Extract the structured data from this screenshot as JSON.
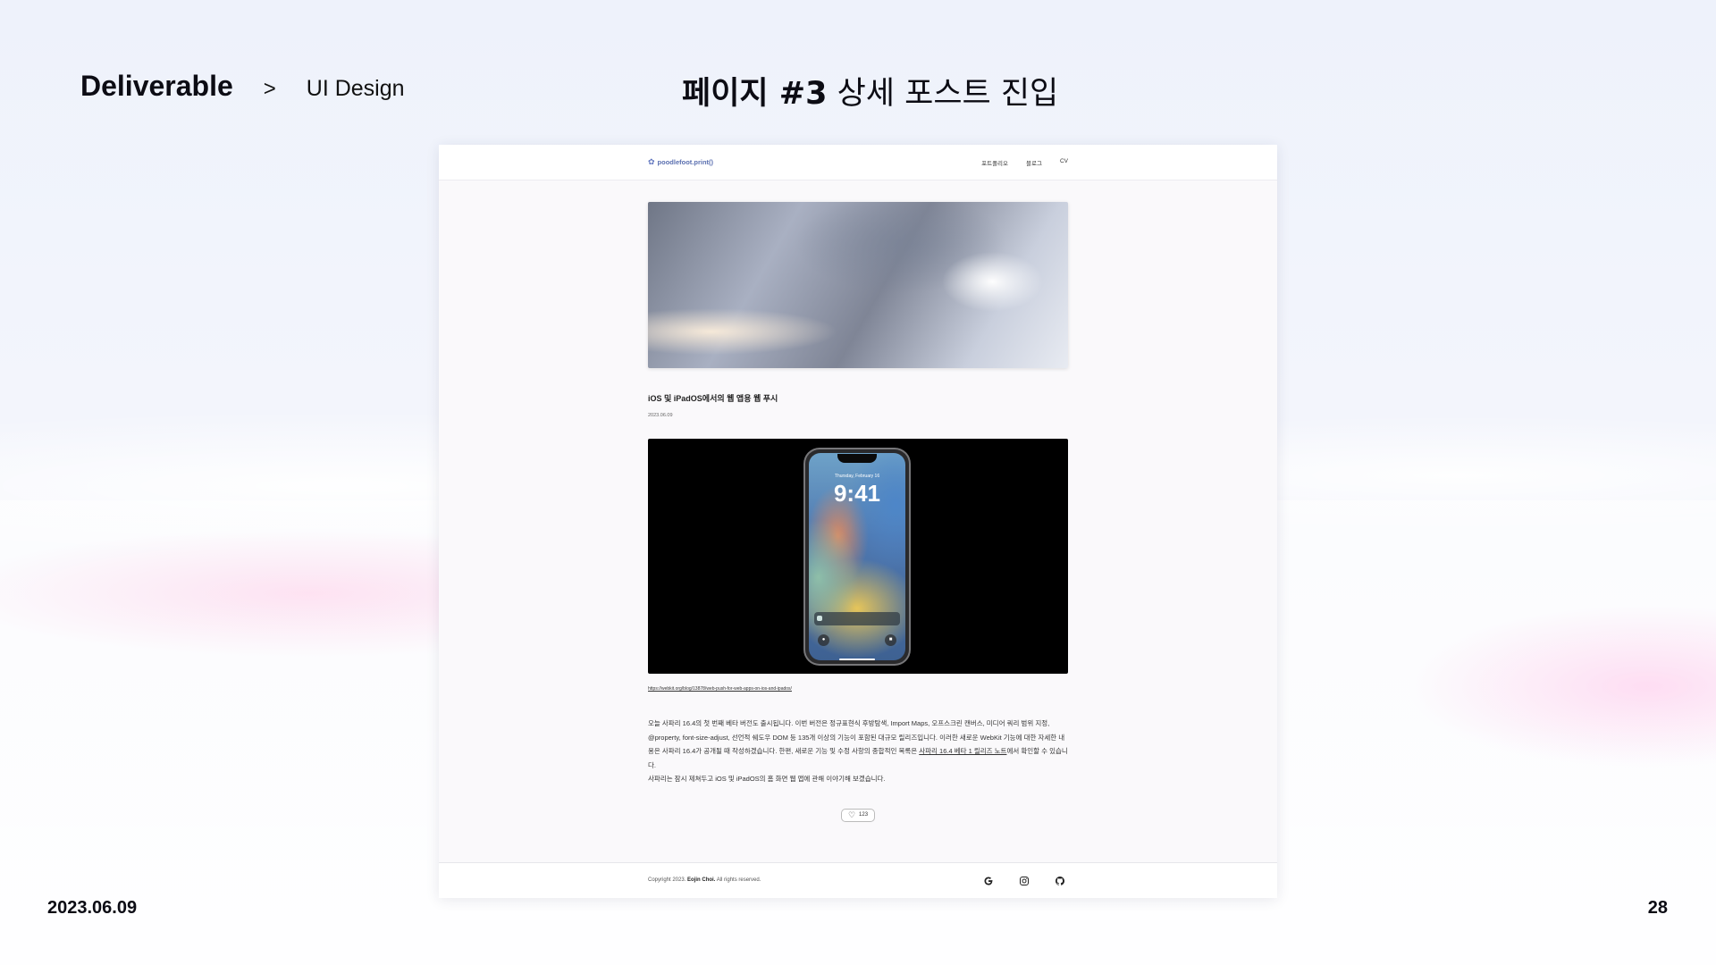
{
  "slide": {
    "section": "Deliverable",
    "separator": ">",
    "subsection": "UI Design",
    "heading_bold": "페이지 #3",
    "heading_rest": " 상세 포스트 진입",
    "date": "2023.06.09",
    "page_number": "28"
  },
  "mockup": {
    "logo_text": "poodlefoot.print()",
    "nav_items": [
      "포트폴리오",
      "블로그",
      "CV"
    ],
    "post": {
      "title": "iOS 및 iPadOS에서의 웹 앱용 웹 푸시",
      "date": "2023.06.09",
      "phone_date": "Thursday, February 16",
      "phone_time": "9:41",
      "link": "https://webkit.org/blog/13878/web-push-for-web-apps-on-ios-and-ipados/",
      "body_part1": "오늘 사파리 16.4의 첫 번째 베타 버전도 출시됩니다. 이번 버전은 정규표현식 후방탐색, Import Maps, 오프스크린 캔버스, 미디어 쿼리 범위 지정, @property, font-size-adjust, 선언적 쉐도우 DOM 등 135개 이상의 기능이 포함된 대규모 릴리즈입니다. 이러한 새로운 WebKit 기능에 대한 자세한 내용은 사파리 16.4가 공개될 때 작성하겠습니다. 한편, 새로운 기능 및 수정 사항의 종합적인 목록은 ",
      "body_link": "사파리 16.4 베타 1 릴리즈 노트",
      "body_part2": "에서 확인할 수 있습니다.",
      "body_line2": "사파리는 잠시 제쳐두고 iOS 및 iPadOS의 홈 화면 웹 앱에 관해 이야기해 보겠습니다.",
      "like_count": "123"
    },
    "footer": {
      "copyright_prefix": "Copyright 2023. ",
      "copyright_name": "Eojin Choi.",
      "copyright_suffix": " All rights reserved.",
      "social_icons": [
        "google-icon",
        "instagram-icon",
        "github-icon"
      ]
    }
  }
}
